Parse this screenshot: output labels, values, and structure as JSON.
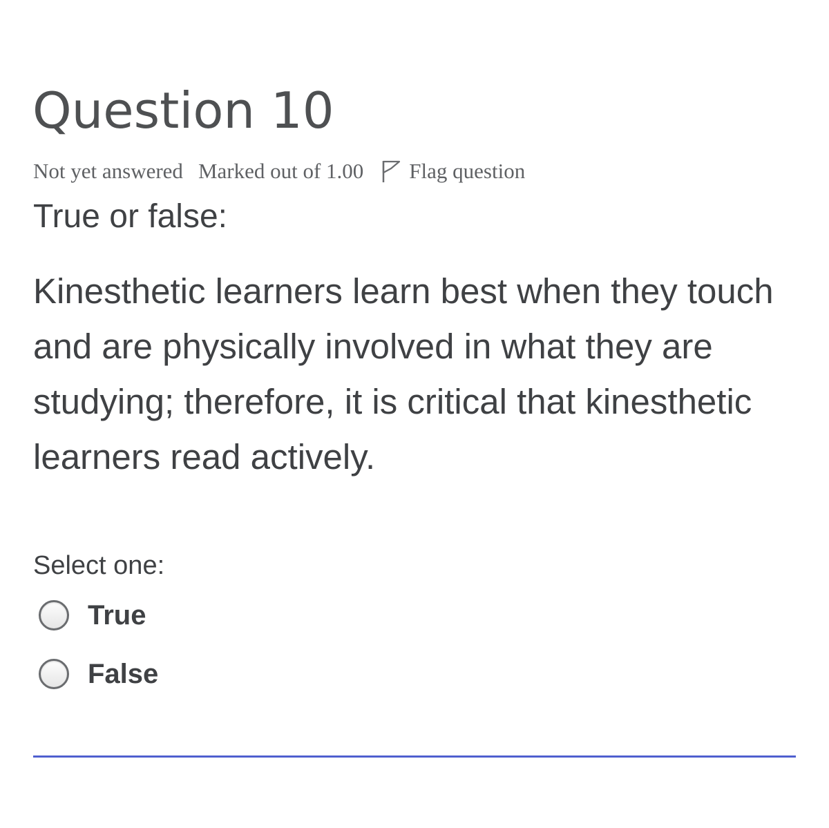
{
  "question": {
    "title": "Question 10",
    "state": "Not yet answered",
    "grade": "Marked out of 1.00",
    "flag_label": "Flag question",
    "type_label": "True or false:",
    "text": "Kinesthetic learners learn best when they touch and are physically involved in what they are studying; therefore, it is critical that kinesthetic learners read actively."
  },
  "answer": {
    "prompt": "Select one:",
    "options": [
      {
        "label": "True",
        "selected": false
      },
      {
        "label": "False",
        "selected": false
      }
    ]
  },
  "colors": {
    "divider": "#4f5fcf",
    "text": "#3f4144"
  },
  "icons": {
    "flag": "flag-icon",
    "radio": "radio-button"
  }
}
